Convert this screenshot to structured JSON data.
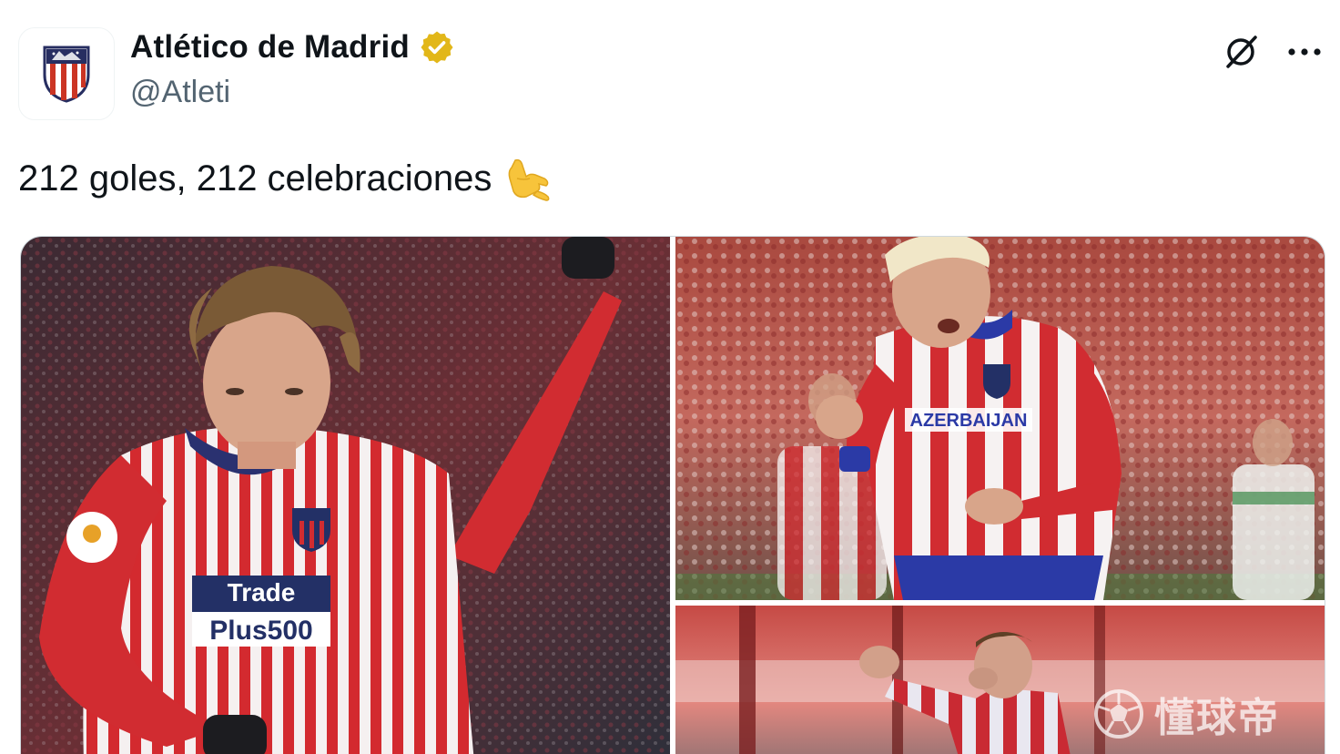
{
  "account": {
    "display_name": "Atlético de Madrid",
    "handle": "@Atleti",
    "verified_badge_color": "#e2b719",
    "avatar_icon": "atletico-crest-icon"
  },
  "header_actions": {
    "grok_icon": "grok-slash-circle-icon",
    "more_icon": "more-horizontal-icon"
  },
  "tweet": {
    "text": "212 goles, 212 celebraciones",
    "emoji": "call-me-hand-emoji"
  },
  "media": {
    "photo_count": 3,
    "photos": [
      {
        "description_icon": "photo-celebration-arm-raised",
        "shirt_sponsor": "Trade Plus500"
      },
      {
        "description_icon": "photo-celebration-dance",
        "shirt_sponsor": "AZERBAIJAN"
      },
      {
        "description_icon": "photo-celebration-phone-gesture"
      }
    ]
  },
  "watermark": {
    "text": "懂球帝",
    "icon": "soccer-ball-icon"
  },
  "colors": {
    "text_primary": "#0f1419",
    "text_secondary": "#536471",
    "border": "#cfd9de",
    "atleti_red": "#cb3524",
    "atleti_blue": "#272e61"
  }
}
